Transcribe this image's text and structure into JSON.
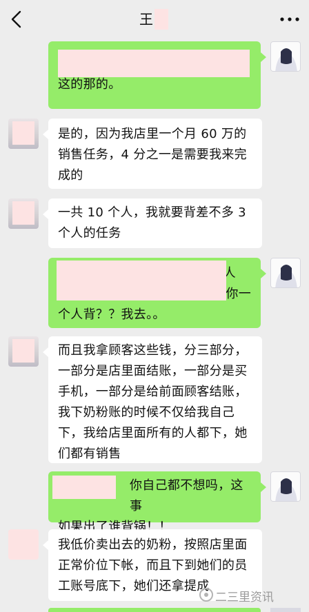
{
  "header": {
    "title": "王",
    "back_icon": "chevron-left-icon",
    "more_icon": "more-dots-icon"
  },
  "messages": [
    {
      "side": "right",
      "lines": [
        "这的那的。"
      ]
    },
    {
      "side": "left",
      "lines": [
        "是的，因为我店里一个月 60 万的",
        "销售任务，4 分之一是需要我来完",
        "成的"
      ]
    },
    {
      "side": "left",
      "lines": [
        "一共 10 个人，我就要背差不多 3",
        "个人的任务"
      ]
    },
    {
      "side": "right",
      "lines": [
        "人",
        "你一",
        "个人背？？我去。。"
      ]
    },
    {
      "side": "left",
      "lines": [
        "而且我拿顾客这些钱，分三部分，",
        "一部分是店里面结账，一部分是买",
        "手机，一部分是给前面顾客结账，",
        "我下奶粉账的时候不仅给我自己",
        "下，我给店里面所有的人都下，她",
        "们都有销售"
      ]
    },
    {
      "side": "right",
      "lines": [
        "你自己都不想吗，这事",
        "如果出了谁背锅！！"
      ]
    },
    {
      "side": "left",
      "lines": [
        "我低价卖出去的奶粉，按照店里面",
        "正常价位下帐，而且下到她们的员",
        "工账号底下，她们还拿提成"
      ]
    }
  ],
  "watermark": "二三里资讯",
  "colors": {
    "background": "#ededed",
    "sent_bubble": "#95ec69",
    "received_bubble": "#ffffff",
    "privacy_mask": "#fde3e3"
  }
}
